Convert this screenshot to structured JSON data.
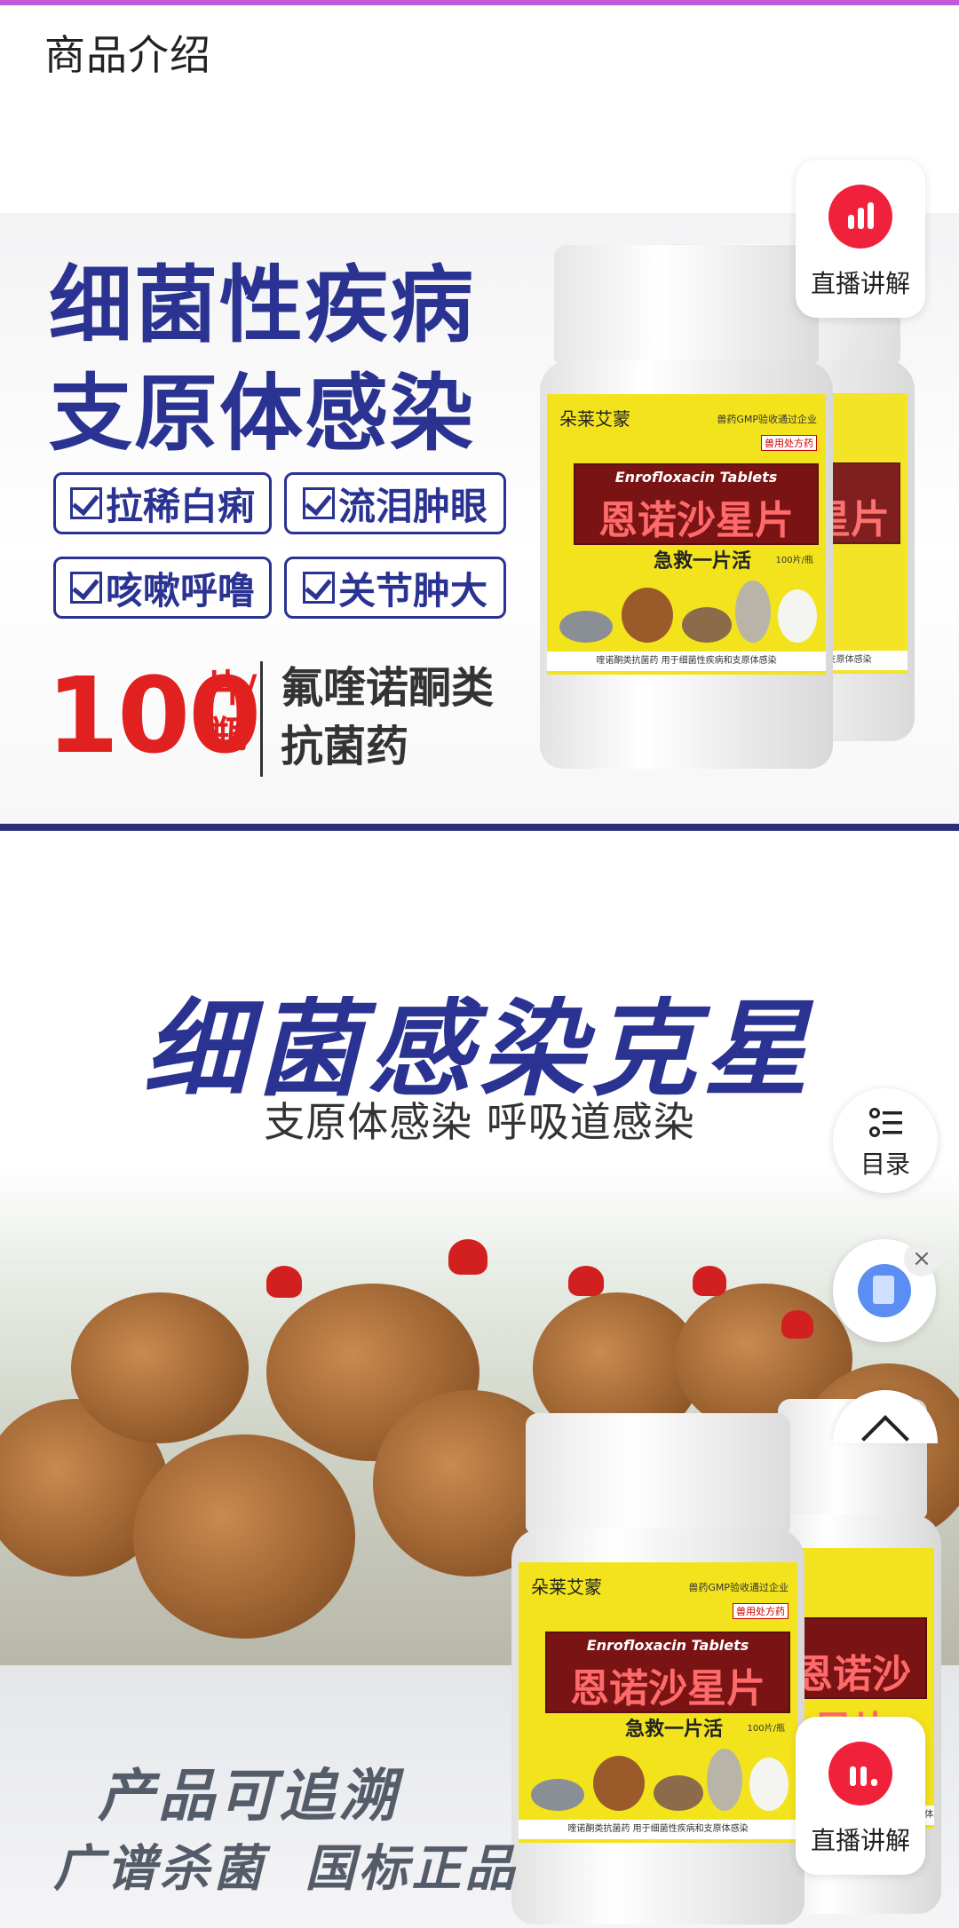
{
  "header": {
    "section_title": "商品介绍"
  },
  "banner1": {
    "headline_line1": "细菌性疾病",
    "headline_line2": "支原体感染",
    "tags": [
      "拉稀白痢",
      "流泪肿眼",
      "咳嗽呼噜",
      "关节肿大"
    ],
    "count": "100",
    "unit_line1": "片/",
    "unit_line2": "瓶",
    "desc_line1": "氟喹诺酮类",
    "desc_line2": "抗菌药"
  },
  "bottle": {
    "brand": "朵莱艾蒙",
    "gmp": "兽药GMP验收通过企业",
    "rx": "兽用处方药",
    "english_name": "Enrofloxacin Tablets",
    "chinese_name": "恩诺沙星片",
    "slogan": "急救一片活",
    "spec": "100片/瓶",
    "footer": "喹诺酮类抗菌药 用于细菌性疾病和支原体感染"
  },
  "banner2": {
    "headline": "细菌感染克星",
    "subheadline": "支原体感染 呼吸道感染",
    "slogan_line1": "产品可追溯",
    "slogan_line2": "广谱杀菌 国标正品"
  },
  "floating": {
    "live_label": "直播讲解",
    "toc_label": "目录",
    "close_glyph": "×"
  },
  "colors": {
    "brand_blue": "#2a3391",
    "accent_red": "#e0211f",
    "live_red": "#f0213b",
    "label_yellow": "#f3e31d"
  }
}
